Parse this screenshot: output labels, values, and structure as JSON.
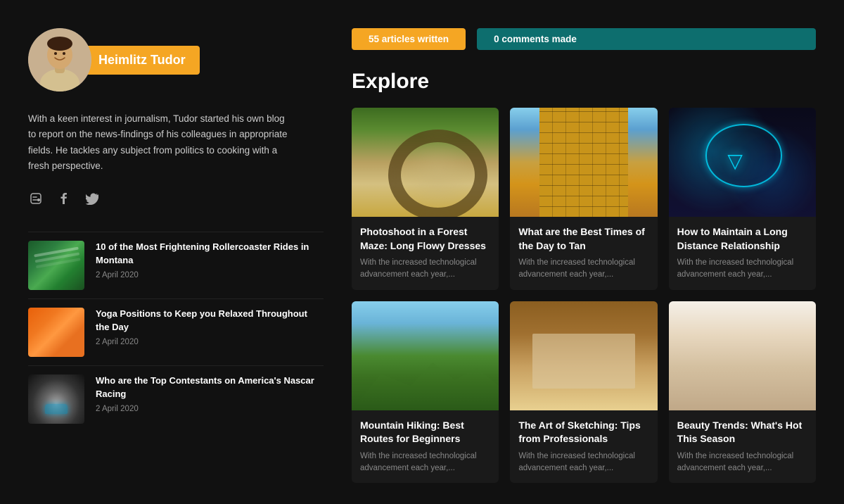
{
  "profile": {
    "name": "Heimlitz Tudor",
    "bio": "With a keen interest in journalism, Tudor started his own blog to report on the news-findings of his colleagues in appropriate fields. He tackles any subject from politics to cooking with a fresh perspective.",
    "avatar_alt": "Heimlitz Tudor avatar"
  },
  "stats": {
    "articles_label": "55 articles written",
    "comments_label": "0 comments made"
  },
  "social": {
    "blogger_icon": "B",
    "facebook_icon": "f",
    "twitter_icon": "t"
  },
  "articles": [
    {
      "title": "10 of the Most Frightening Rollercoaster Rides in Montana",
      "date": "2 April 2020",
      "thumb_class": "thumb-roller"
    },
    {
      "title": "Yoga Positions to Keep you Relaxed Throughout the Day",
      "date": "2 April 2020",
      "thumb_class": "thumb-yoga"
    },
    {
      "title": "Who are the Top Contestants on America's Nascar Racing",
      "date": "2 April 2020",
      "thumb_class": "thumb-smoke"
    }
  ],
  "explore": {
    "heading": "Explore",
    "cards": [
      {
        "title": "Photoshoot in a Forest Maze: Long Flowy Dresses",
        "excerpt": "With the increased technological advancement each year,...",
        "img_class": "img-forest"
      },
      {
        "title": "What are the Best Times of the Day to Tan",
        "excerpt": "With the increased technological advancement each year,...",
        "img_class": "img-building"
      },
      {
        "title": "How to Maintain a Long Distance Relationship",
        "excerpt": "With the increased technological advancement each year,...",
        "img_class": "img-neon"
      },
      {
        "title": "Mountain Hiking: Best Routes for Beginners",
        "excerpt": "With the increased technological advancement each year,...",
        "img_class": "img-mountain"
      },
      {
        "title": "The Art of Sketching: Tips from Professionals",
        "excerpt": "With the increased technological advancement each year,...",
        "img_class": "img-drawing"
      },
      {
        "title": "Beauty Trends: What's Hot This Season",
        "excerpt": "With the increased technological advancement each year,...",
        "img_class": "img-woman"
      }
    ]
  }
}
